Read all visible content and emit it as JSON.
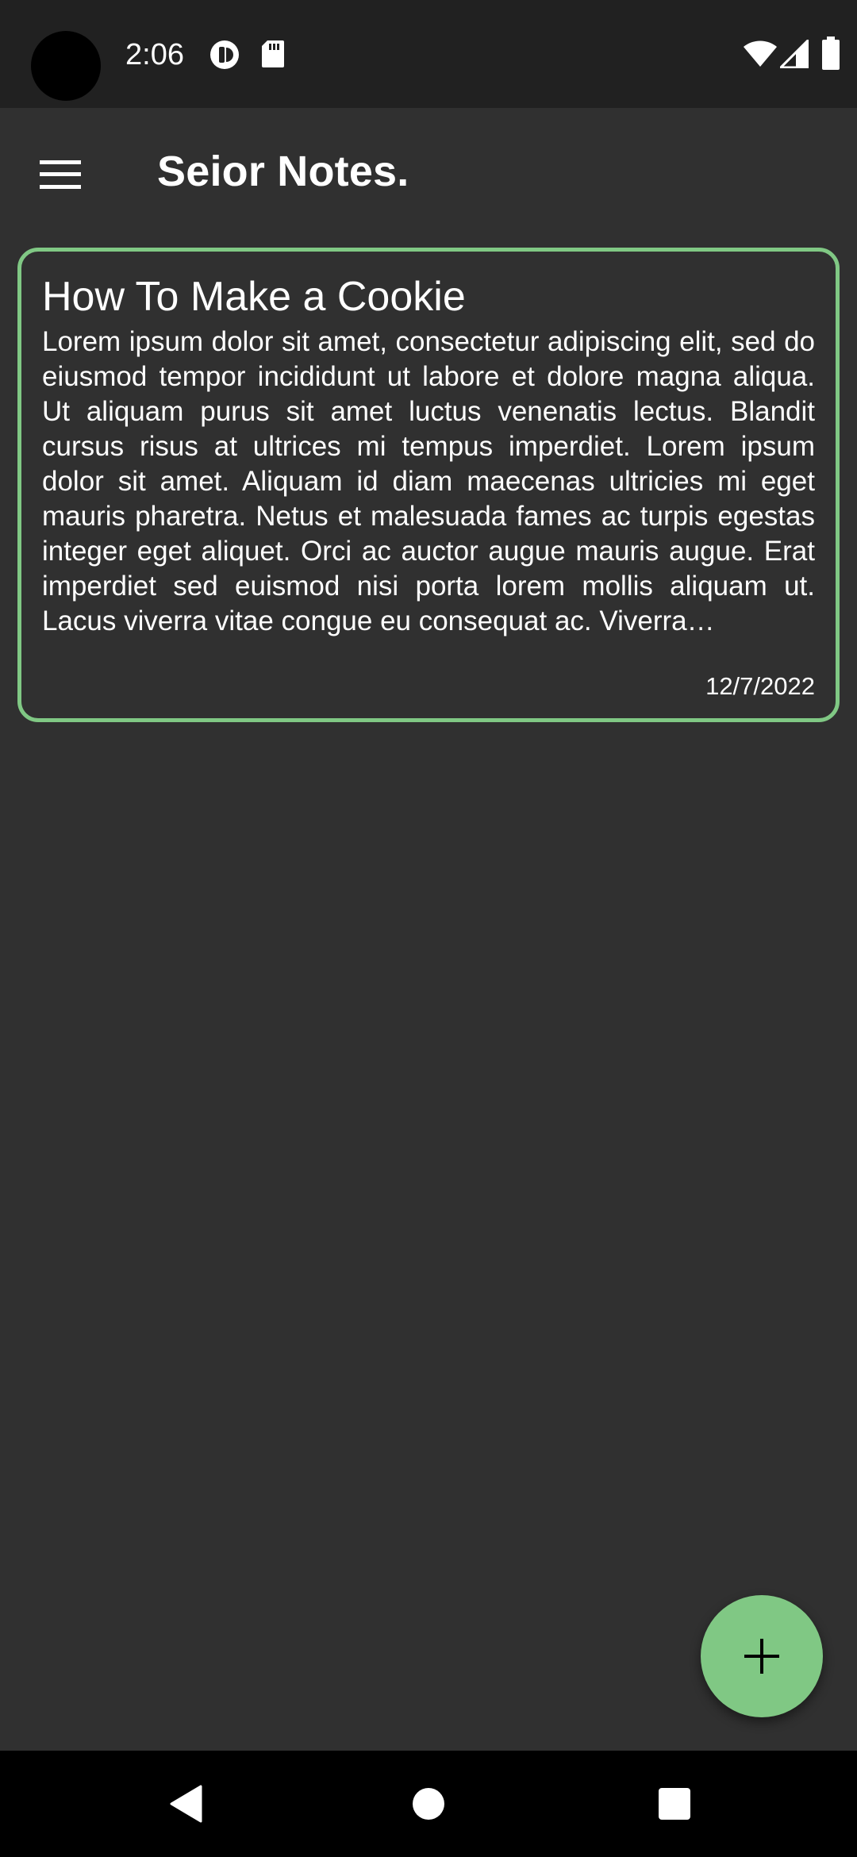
{
  "status_bar": {
    "time": "2:06",
    "icons": [
      "notification-app-icon",
      "sd-card-icon",
      "wifi-icon",
      "cell-signal-icon",
      "battery-icon"
    ]
  },
  "app_bar": {
    "title": "Seior Notes.",
    "menu_icon": "hamburger-menu-icon"
  },
  "notes": [
    {
      "title": "How To Make a Cookie",
      "body": "Lorem ipsum dolor sit amet, consectetur adipiscing elit, sed do eiusmod tempor incididunt ut labore et dolore magna aliqua. Ut aliquam purus sit amet luctus venenatis lectus. Blandit cursus risus at ultrices mi tempus imperdiet. Lorem ipsum dolor sit amet. Aliquam id diam maecenas ultricies mi eget mauris pharetra. Netus et malesuada fames ac turpis egestas integer eget aliquet. Orci ac auctor augue mauris augue. Erat imperdiet sed euismod nisi porta lorem mollis aliquam ut. Lacus viverra vitae congue eu consequat ac. Viverra…",
      "date": "12/7/2022"
    }
  ],
  "fab": {
    "icon": "plus-icon"
  },
  "nav_bar": {
    "icons": [
      "back-icon",
      "home-icon",
      "recents-icon"
    ]
  },
  "colors": {
    "background": "#303030",
    "status_bar": "#212121",
    "accent": "#80c884",
    "nav_bar": "#000000",
    "text": "#ffffff"
  }
}
